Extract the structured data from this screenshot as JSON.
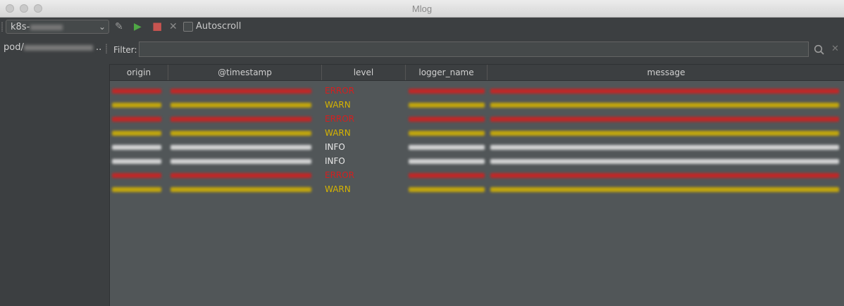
{
  "window": {
    "title": "Mlog"
  },
  "toolbar": {
    "connection_prefix": "k8s-",
    "autoscroll_label": "Autoscroll",
    "autoscroll_checked": false
  },
  "sidebar": {
    "pod_prefix": "pod/"
  },
  "filter": {
    "label": "Filter:",
    "value": ""
  },
  "table": {
    "columns": [
      "origin",
      "@timestamp",
      "level",
      "logger_name",
      "message"
    ],
    "rows": [
      {
        "level": "ERROR",
        "color": "#d41f1f"
      },
      {
        "level": "WARN",
        "color": "#d6b400"
      },
      {
        "level": "ERROR",
        "color": "#d41f1f"
      },
      {
        "level": "WARN",
        "color": "#d6b400"
      },
      {
        "level": "INFO",
        "color": "#e8e8e8"
      },
      {
        "level": "INFO",
        "color": "#e8e8e8"
      },
      {
        "level": "ERROR",
        "color": "#d41f1f"
      },
      {
        "level": "WARN",
        "color": "#d6b400"
      }
    ]
  },
  "colors": {
    "error": "#d41f1f",
    "warn": "#d6b400",
    "info": "#e8e8e8",
    "background": "#3c3f41"
  }
}
